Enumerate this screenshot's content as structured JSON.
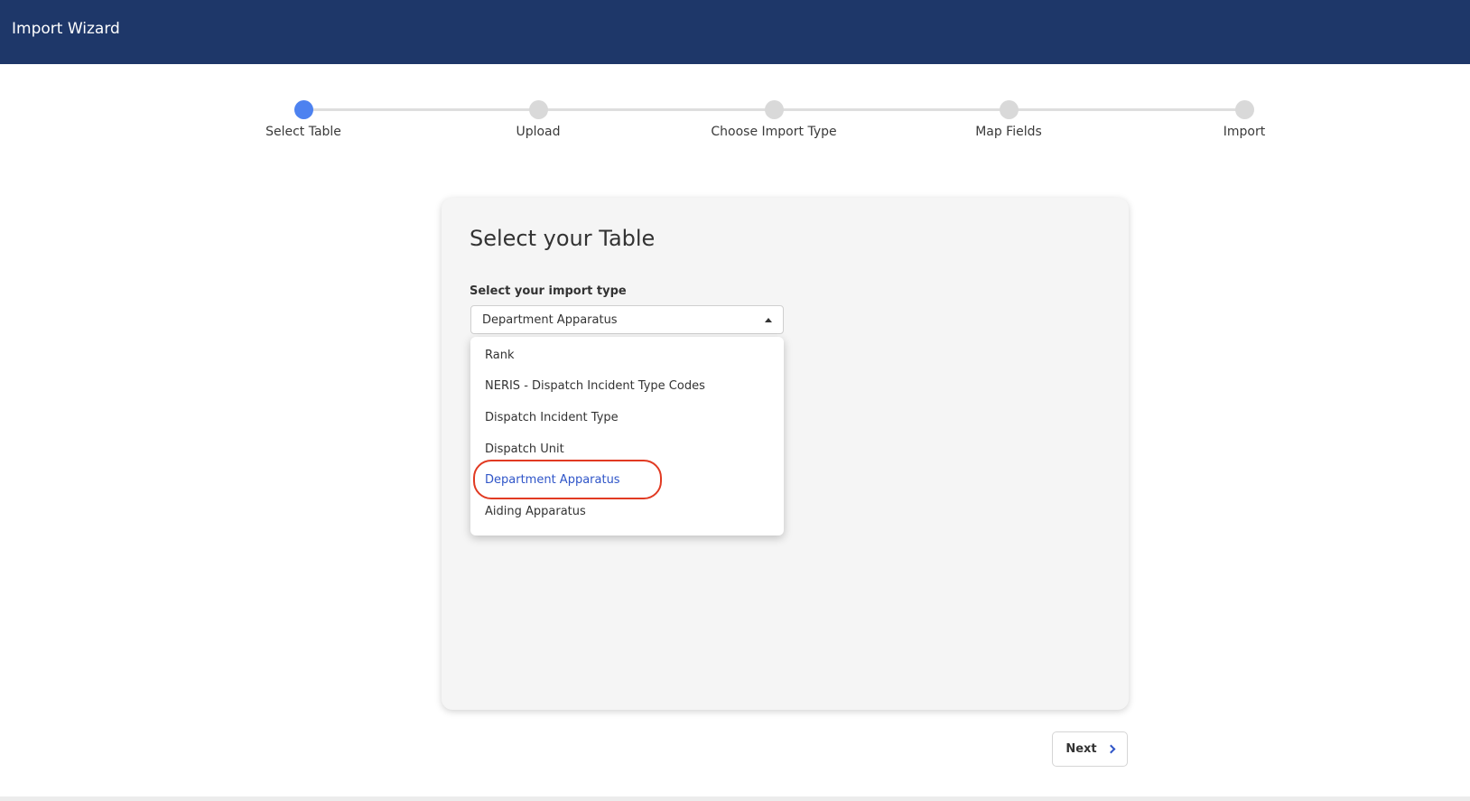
{
  "header": {
    "title": "Import Wizard"
  },
  "stepper": {
    "steps": [
      {
        "label": "Select Table",
        "active": true
      },
      {
        "label": "Upload",
        "active": false
      },
      {
        "label": "Choose Import Type",
        "active": false
      },
      {
        "label": "Map Fields",
        "active": false
      },
      {
        "label": "Import",
        "active": false
      }
    ]
  },
  "card": {
    "title": "Select your Table",
    "field_label": "Select your import type",
    "selected_value": "Department Apparatus"
  },
  "dropdown": {
    "options": [
      {
        "label": "Rank",
        "selected": false
      },
      {
        "label": "NERIS - Dispatch Incident Type Codes",
        "selected": false
      },
      {
        "label": "Dispatch Incident Type",
        "selected": false
      },
      {
        "label": "Dispatch Unit",
        "selected": false
      },
      {
        "label": "Department Apparatus",
        "selected": true
      },
      {
        "label": "Aiding Apparatus",
        "selected": false
      }
    ]
  },
  "footer": {
    "next_label": "Next"
  },
  "colors": {
    "header_bg": "#1e3769",
    "active_step": "#4d82f0",
    "selected_option": "#2f55c8",
    "highlight_ring": "#e13a22"
  },
  "icons": {
    "select_caret": "caret-up-icon",
    "next": "chevron-right-icon"
  }
}
